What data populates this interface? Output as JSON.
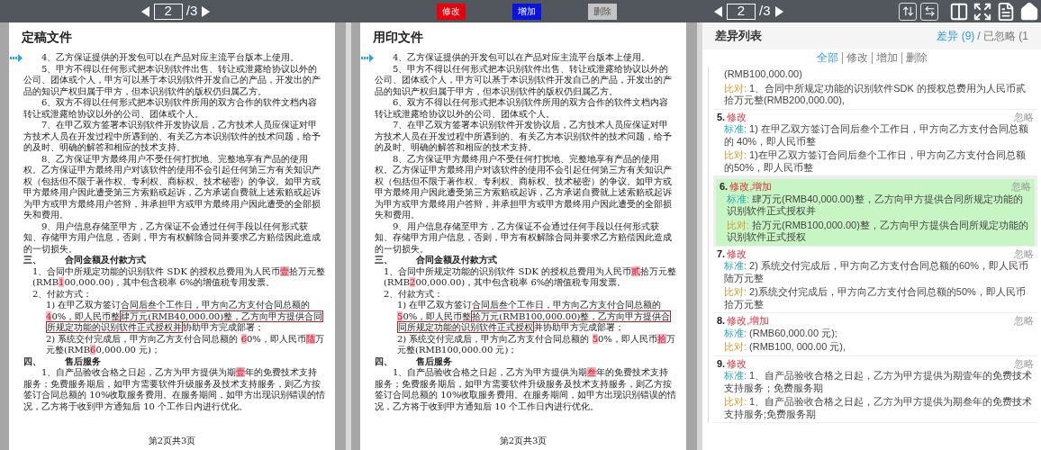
{
  "toolbar": {
    "left_pager": {
      "page": "2",
      "total": "/3"
    },
    "legend": [
      {
        "label": "修改",
        "color": "#e8000b",
        "disabled": false
      },
      {
        "label": "增加",
        "color": "#0a14e0",
        "disabled": false
      },
      {
        "label": "删除",
        "color": "#c4c4c4",
        "disabled": true
      }
    ],
    "right_pager": {
      "page": "2",
      "total": "/3"
    }
  },
  "documents": [
    {
      "title": "定稿文件",
      "footer": "第2页共3页",
      "paragraphs": [
        {
          "kind": "para",
          "marked": true,
          "runs": [
            {
              "text": "4、乙方保证提供的开发包可以在产品对应主流平台版本上使用。",
              "changed": false
            }
          ]
        },
        {
          "kind": "para",
          "marked": false,
          "runs": [
            {
              "text": "5、甲方不得以任何形式把本识别软件出售、转让或泄露给协议以外的公司、团体或个人，甲方可以基于本识别软件开发自己的产品，开发出的产品的知识产权归属于甲方，但本识别软件的版权仍归属乙方。",
              "changed": false
            }
          ]
        },
        {
          "kind": "para",
          "marked": false,
          "runs": [
            {
              "text": "6、双方不得以任何形式把本识别软件所用的双方合作的软件文档内容转让或泄露给协议以外的公司、团体或个人。",
              "changed": false
            }
          ]
        },
        {
          "kind": "para",
          "marked": false,
          "runs": [
            {
              "text": "7、在甲乙双方签署本识别软件开发协议后，乙方技术人员应保证对甲方技术人员在开发过程中所遇到的、有关乙方本识别软件的技术问题，给予的及时、明确的解答和相应的技术支持。",
              "changed": false
            }
          ]
        },
        {
          "kind": "para",
          "marked": false,
          "runs": [
            {
              "text": "8、乙方保证甲方最终用户不受任何打扰地、完整地享有产品的使用权。乙方保证甲方最终用户对该软件的使用不会引起任何第三方有关知识产权（包括但不限于著作权、专利权、商标权、技术秘密）的争议。如甲方或甲方最终用户因此遭受第三方索赔或起诉，乙方承诺自费就上述索赔或起诉为甲方或甲方最终用户答辩，并承担甲方或甲方最终用户因此遭受的全部损失和费用。",
              "changed": false
            }
          ]
        },
        {
          "kind": "para",
          "marked": false,
          "runs": [
            {
              "text": "9、用户信息存储至甲方，乙方保证不会通过任何手段以任何形式获知、存储甲方用户信息，否则，甲方有权解除合同并要求乙方赔偿因此造成的一切损失。",
              "changed": false
            }
          ]
        },
        {
          "kind": "heading",
          "number": "三、",
          "text": "合同金额及付款方式"
        },
        {
          "kind": "clause",
          "marked": false,
          "runs": [
            {
              "text": "1、合同中所规定功能的识别软件 SDK 的授权总费用为人民币",
              "changed": false
            },
            {
              "text": "壹",
              "changed": true
            },
            {
              "text": "拾万元整(RMB",
              "changed": false
            },
            {
              "text": "1",
              "changed": true
            },
            {
              "text": "00,000.00)，其中包含税率 6%的增值税专用发票。",
              "changed": false
            }
          ]
        },
        {
          "kind": "clause",
          "marked": false,
          "runs": [
            {
              "text": "2、付款方式：",
              "changed": false
            }
          ]
        },
        {
          "kind": "sub",
          "marked": false,
          "runs": [
            {
              "text": "1) 在甲乙双方签订合同后叁个工作日，甲方向乙方支付合同总额的",
              "changed": false
            },
            {
              "text": "4",
              "changed": true
            },
            {
              "text": "0%，即人民币整",
              "changed": false
            },
            {
              "text": "肆万元(RMB40,000.00)整，乙方向甲方提供合同所规定功能的识别软件正式授权并",
              "changed": false,
              "boxed": true
            },
            {
              "text": "协助甲方完成部署；",
              "changed": false
            }
          ]
        },
        {
          "kind": "sub",
          "marked": false,
          "runs": [
            {
              "text": "2) 系统交付完成后，甲方向乙方支付合同总额的 ",
              "changed": false
            },
            {
              "text": "6",
              "changed": true
            },
            {
              "text": "0%，即人民币",
              "changed": false
            },
            {
              "text": "陆",
              "changed": true
            },
            {
              "text": "万元整(RMB",
              "changed": false
            },
            {
              "text": "6",
              "changed": true
            },
            {
              "text": "0,000.00 元)；",
              "changed": false
            }
          ]
        },
        {
          "kind": "heading",
          "number": "四、",
          "text": "售后服务"
        },
        {
          "kind": "para",
          "marked": false,
          "runs": [
            {
              "text": "1、自产品验收合格之日起，乙方为甲方提供为期",
              "changed": false
            },
            {
              "text": "壹",
              "changed": true
            },
            {
              "text": "年的免费技术支持服务；免费服务期后，如甲方需要软件升级服务及技术支持服务，则乙方按签订合同总额的 10%收取服务费用。在服务期间，如甲方出现识别错误的情况，乙方将于收到甲方通知后 10 个工作日内进行优化。",
              "changed": false
            }
          ]
        }
      ]
    },
    {
      "title": "用印文件",
      "footer": "第2页共3页",
      "paragraphs": [
        {
          "kind": "para",
          "marked": true,
          "runs": [
            {
              "text": "4、乙方保证提供的开发包可以在产品对应主流平台版本上使用。",
              "changed": false
            }
          ]
        },
        {
          "kind": "para",
          "marked": false,
          "runs": [
            {
              "text": "5、甲方不得以任何形式把本识别软件出售、转让或泄露给协议以外的公司、团体或个人，甲方可以基于本识别软件开发自己的产品，开发出的产品的知识产权归属于甲方，但本识别软件的版权仍归属乙方。",
              "changed": false
            }
          ]
        },
        {
          "kind": "para",
          "marked": false,
          "runs": [
            {
              "text": "6、双方不得以任何形式把本识别软件所用的双方合作的软件文档内容转让或泄露给协议以外的公司、团体或个人。",
              "changed": false
            }
          ]
        },
        {
          "kind": "para",
          "marked": false,
          "runs": [
            {
              "text": "7、在甲乙双方签署本识别软件开发协议后，乙方技术人员应保证对甲方技术人员在开发过程中所遇到的、有关乙方本识别软件的技术问题，给予的及时、明确的解答和相应的技术支持。",
              "changed": false
            }
          ]
        },
        {
          "kind": "para",
          "marked": false,
          "runs": [
            {
              "text": "8、乙方保证甲方最终用户不受任何打扰地、完整地享有产品的使用权。乙方保证甲方最终用户对该软件的使用不会引起任何第三方有关知识产权（包括但不限于著作权、专利权、商标权、技术秘密）的争议。如甲方或甲方最终用户因此遭受第三方索赔或起诉，乙方承诺自费就上述索赔或起诉为甲方或甲方最终用户答辩，并承担甲方或甲方最终用户因此遭受的全部损失和费用。",
              "changed": false
            }
          ]
        },
        {
          "kind": "para",
          "marked": false,
          "runs": [
            {
              "text": "9、用户信息存储至甲方，乙方保证不会通过任何手段以任何形式获知、存储甲方用户信息，否则，甲方有权解除合同并要求乙方赔偿因此造成的一切损失。",
              "changed": false
            }
          ]
        },
        {
          "kind": "heading",
          "number": "三、",
          "text": "合同金额及付款方式"
        },
        {
          "kind": "clause",
          "marked": false,
          "runs": [
            {
              "text": "1、合同中所规定功能的识别软件 SDK 的授权总费用为人民币",
              "changed": false
            },
            {
              "text": "贰",
              "changed": true
            },
            {
              "text": "拾万元整(RMB",
              "changed": false
            },
            {
              "text": "2",
              "changed": true
            },
            {
              "text": "00,000.00)，其中包含税率 6%的增值税专用发票。",
              "changed": false
            }
          ]
        },
        {
          "kind": "clause",
          "marked": false,
          "runs": [
            {
              "text": "2、付款方式：",
              "changed": false
            }
          ]
        },
        {
          "kind": "sub",
          "marked": false,
          "runs": [
            {
              "text": "1) 在甲乙双方签订合同后叁个工作日，甲方向乙方支付合同总额的",
              "changed": false
            },
            {
              "text": "5",
              "changed": true
            },
            {
              "text": "0%，即人民币整",
              "changed": false
            },
            {
              "text": "拾万元(RMB100,000.00)整，乙方向甲方提供合同所规定功能的识别软件正式授权",
              "changed": false,
              "boxed": true
            },
            {
              "text": "并协助甲方完成部署；",
              "changed": false
            }
          ]
        },
        {
          "kind": "sub",
          "marked": false,
          "runs": [
            {
              "text": "2) 系统交付完成后，甲方向乙方支付合同总额的 ",
              "changed": false
            },
            {
              "text": "5",
              "changed": true
            },
            {
              "text": "0%，即人民币",
              "changed": false
            },
            {
              "text": "拾",
              "changed": true
            },
            {
              "text": "万元整(RMB100,000.00 元)；",
              "changed": false
            }
          ]
        },
        {
          "kind": "heading",
          "number": "四、",
          "text": "售后服务"
        },
        {
          "kind": "para",
          "marked": false,
          "runs": [
            {
              "text": "1、自产品验收合格之日起，乙方为甲方提供为期",
              "changed": false
            },
            {
              "text": "叁",
              "changed": true
            },
            {
              "text": "年的免费技术支持服务；免费服务期后，如甲方需要软件升级服务及技术支持服务，则乙方按签订合同总额的 10%收取服务费用。在服务期间，如甲方出现识别错误的情况，乙方将于收到甲方通知后 10 个工作日内进行优化。",
              "changed": false
            }
          ]
        }
      ]
    }
  ],
  "diff_panel": {
    "title": "差异列表",
    "count": "差异 (9)",
    "ignored": "/ 已忽略 (1",
    "filters": [
      {
        "label": "全部",
        "selected": true
      },
      {
        "label": "修改",
        "selected": false
      },
      {
        "label": "增加",
        "selected": false
      },
      {
        "label": "删除",
        "selected": false
      }
    ],
    "items": [
      {
        "selected": false,
        "standard": "(RMB100,000.00)",
        "compare_label": "比对:",
        "compare": "1、合同中所规定功能的识别软件SDK 的授权总费用为人民币贰拾万元整(RMB200,000.00),"
      },
      {
        "selected": false,
        "number": "5.",
        "types": "修改",
        "ignore": "忽略",
        "standard_label": "标准:",
        "standard": "1) 在甲乙双方签订合同后叁个工作日，甲方向乙方支付合同总额的 40%，即人民币整",
        "compare_label": "比对:",
        "compare": "1)在甲乙双方签订合同后叁个工作日，甲方向乙方支付合同总额的50%，即人民币整"
      },
      {
        "selected": true,
        "number": "6.",
        "types": "修改,增加",
        "ignore": "忽略",
        "standard_label": "标准:",
        "standard": "肆万元(RMB40,000.00)整，乙方向甲方提供合同所规定功能的识别软件正式授权并",
        "compare_label": "比对:",
        "compare": "拾万元(RMB100,000.00)整，乙方向甲方提供合同所规定功能的识别软件正式授权"
      },
      {
        "selected": false,
        "number": "7.",
        "types": "修改",
        "ignore": "忽略",
        "standard_label": "标准:",
        "standard": "2) 系统交付完成后，甲方向乙方支付合同总额的60%，即人民币陆万元整",
        "compare_label": "比对:",
        "compare": "2)系统交付完成后，甲方向乙方支付合同总额的50%，即人民币拾万元整"
      },
      {
        "selected": false,
        "number": "8.",
        "types": "修改,增加",
        "ignore": "忽略",
        "standard_label": "标准:",
        "standard": "(RMB60,000.00 元);",
        "compare_label": "比对:",
        "compare": "(RMB100, 000.00 元),"
      },
      {
        "selected": false,
        "number": "9.",
        "types": "修改",
        "ignore": "忽略",
        "standard_label": "标准:",
        "standard": "1、自产品验收合格之日起，乙方为甲方提供为期壹年的免费技术支持服务；免费服务期",
        "compare_label": "比对:",
        "compare": "1、自产品验收合格之日起，乙方为甲方提供为期叁年的免费技术支持服务;免费服务期"
      }
    ]
  }
}
